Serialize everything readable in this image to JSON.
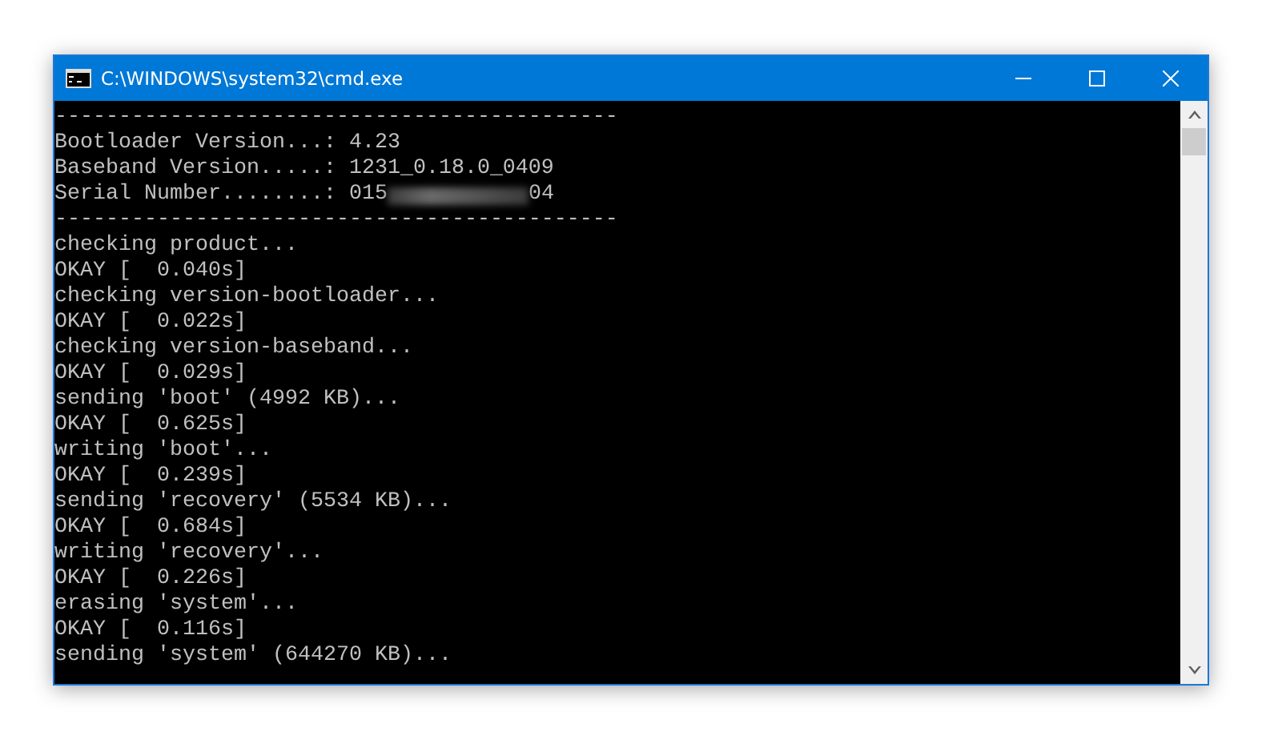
{
  "window": {
    "title": "C:\\WINDOWS\\system32\\cmd.exe"
  },
  "console": {
    "lines": [
      {
        "text": "--------------------------------------------"
      },
      {
        "text": "Bootloader Version...: 4.23"
      },
      {
        "text": "Baseband Version.....: 1231_0.18.0_0409"
      },
      {
        "text": "Serial Number........: 015",
        "after_blur": "04"
      },
      {
        "text": "--------------------------------------------"
      },
      {
        "text": "checking product..."
      },
      {
        "text": "OKAY [  0.040s]"
      },
      {
        "text": "checking version-bootloader..."
      },
      {
        "text": "OKAY [  0.022s]"
      },
      {
        "text": "checking version-baseband..."
      },
      {
        "text": "OKAY [  0.029s]"
      },
      {
        "text": "sending 'boot' (4992 KB)..."
      },
      {
        "text": "OKAY [  0.625s]"
      },
      {
        "text": "writing 'boot'..."
      },
      {
        "text": "OKAY [  0.239s]"
      },
      {
        "text": "sending 'recovery' (5534 KB)..."
      },
      {
        "text": "OKAY [  0.684s]"
      },
      {
        "text": "writing 'recovery'..."
      },
      {
        "text": "OKAY [  0.226s]"
      },
      {
        "text": "erasing 'system'..."
      },
      {
        "text": "OKAY [  0.116s]"
      },
      {
        "text": "sending 'system' (644270 KB)..."
      }
    ]
  }
}
